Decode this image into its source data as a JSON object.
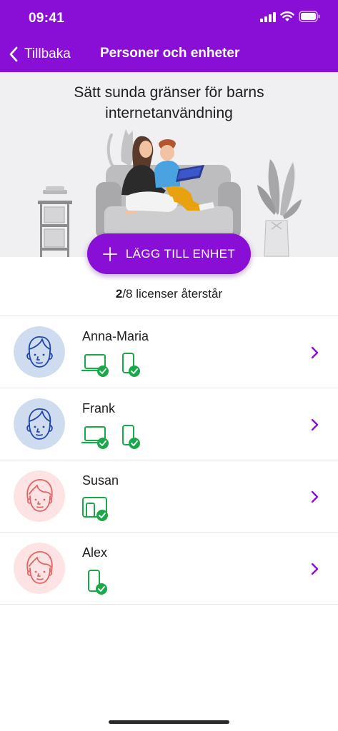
{
  "status_bar": {
    "time": "09:41"
  },
  "nav": {
    "back_label": "Tillbaka",
    "title": "Personer och enheter"
  },
  "hero": {
    "title": "Sätt sunda gränser för barns internetanvändning"
  },
  "add_device": {
    "label": "LÄGG TILL ENHET"
  },
  "licenses": {
    "remaining": "2",
    "rest": "/8 licenser återstår"
  },
  "colors": {
    "accent": "#8a0fd6",
    "device_green": "#1aa84a",
    "boy_avatar_bg": "#cfdbef",
    "girl_avatar_bg": "#fde3e3"
  },
  "people": [
    {
      "name": "Anna-Maria",
      "avatar": "boy-face-icon",
      "devices": [
        "laptop-icon",
        "phone-icon"
      ]
    },
    {
      "name": "Frank",
      "avatar": "boy-face-icon",
      "devices": [
        "laptop-icon",
        "phone-icon"
      ]
    },
    {
      "name": "Susan",
      "avatar": "girl-face-icon",
      "devices": [
        "tablet-icon"
      ]
    },
    {
      "name": "Alex",
      "avatar": "girl-face-icon",
      "devices": [
        "phone-icon"
      ]
    }
  ]
}
